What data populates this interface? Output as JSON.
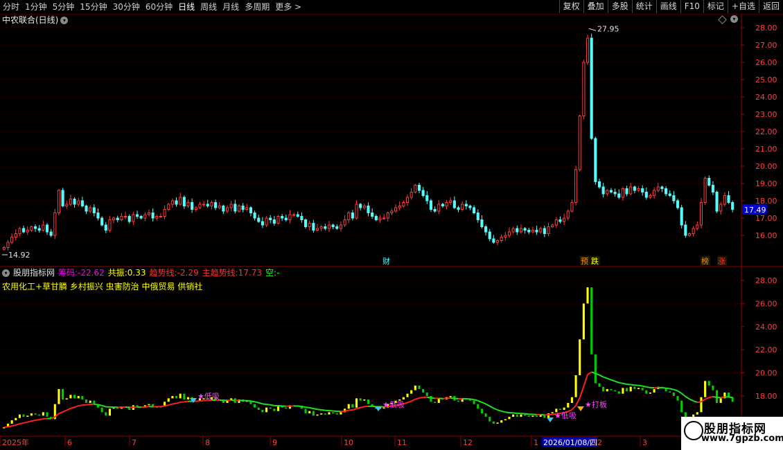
{
  "toolbar": {
    "periods": [
      "分时",
      "1分钟",
      "5分钟",
      "15分钟",
      "30分钟",
      "60分钟",
      "日线",
      "周线",
      "月线",
      "多周期",
      "更多 >"
    ],
    "active_period": "日线",
    "buttons": [
      "复权",
      "叠加",
      "多股",
      "统计",
      "画线",
      "F10",
      "标记",
      "+自选",
      "返回"
    ]
  },
  "main_panel": {
    "title": "中农联合(日线)"
  },
  "indicator": {
    "name": "股朋指标网",
    "chouma_label": "筹码:",
    "chouma_value": "-22.62",
    "gongzhen_label": "共振:",
    "gongzhen_value": "0.33",
    "qushi_label": "趋势线:",
    "qushi_value": "-2.29",
    "zhu_label": "主趋势线:",
    "zhu_value": "17.73",
    "kong_label": "空:",
    "kong_value": "-",
    "concepts": "农用化工+草甘膦 乡村振兴 虫害防治 中俄贸易 供销社"
  },
  "watermark": {
    "line1": "股朋指标网",
    "line2": "www.7gpzb.com"
  },
  "colors": {
    "up": "#ff3c3c",
    "down": "#54fcfc",
    "grid": "#5a0000",
    "trend_up": "#ff2020",
    "trend_down": "#20e020",
    "vol_up": "#ffff00",
    "vol_down": "#00cc00"
  },
  "chart_data": {
    "type": "candlestick",
    "y_ticks_main": [
      "28.00",
      "27.00",
      "26.00",
      "25.00",
      "24.00",
      "23.00",
      "22.00",
      "21.00",
      "20.00",
      "19.00",
      "18.00",
      "17.00",
      "16.00"
    ],
    "y_ticks_ind": [
      "28.00",
      "26.00",
      "24.00",
      "22.00",
      "20.00",
      "18.00"
    ],
    "ylim_main": [
      15.3,
      28.4
    ],
    "ylim_ind": [
      16.2,
      28.8
    ],
    "x_labels": [
      "2025年",
      "6",
      "7",
      "8",
      "9",
      "10",
      "11",
      "12",
      "1",
      "2026/01/08/四",
      "2",
      "3"
    ],
    "max_label": "27.95",
    "min_label": "14.92",
    "last_price": "17.49",
    "event_markers": [
      "财",
      "预",
      "跌",
      "榜",
      "涨"
    ],
    "signal_labels": [
      "低吸",
      "低吸",
      "低吸",
      "打板"
    ],
    "closes": [
      15.3,
      15.6,
      15.9,
      16.1,
      16.4,
      16.2,
      16.3,
      16.5,
      16.4,
      16.3,
      16.6,
      16.2,
      16.0,
      17.3,
      18.6,
      17.7,
      17.8,
      18.1,
      17.8,
      18.0,
      17.7,
      17.4,
      17.6,
      17.3,
      17.0,
      16.6,
      16.3,
      16.9,
      17.0,
      16.9,
      17.1,
      17.1,
      16.8,
      17.2,
      17.1,
      17.0,
      17.2,
      17.3,
      17.0,
      17.1,
      17.1,
      17.5,
      17.8,
      18.0,
      17.8,
      18.2,
      17.7,
      17.9,
      17.5,
      17.6,
      17.8,
      17.8,
      17.7,
      17.9,
      17.6,
      17.7,
      17.4,
      17.6,
      17.8,
      17.4,
      17.7,
      17.5,
      17.6,
      17.3,
      17.0,
      16.8,
      16.6,
      17.0,
      16.9,
      16.7,
      17.1,
      17.0,
      16.9,
      17.2,
      17.2,
      17.1,
      16.9,
      16.5,
      16.7,
      16.3,
      16.4,
      16.5,
      16.4,
      16.6,
      16.5,
      16.4,
      16.6,
      16.9,
      17.3,
      17.0,
      17.8,
      17.6,
      17.7,
      17.3,
      17.1,
      16.9,
      17.0,
      17.0,
      17.3,
      17.4,
      17.6,
      17.7,
      17.9,
      18.2,
      18.5,
      18.9,
      18.6,
      18.3,
      18.0,
      17.5,
      17.4,
      17.8,
      17.7,
      17.9,
      18.0,
      17.6,
      17.5,
      17.8,
      17.7,
      17.6,
      17.3,
      16.9,
      16.5,
      16.2,
      15.8,
      15.6,
      15.7,
      15.9,
      16.0,
      16.2,
      16.4,
      16.2,
      16.4,
      16.3,
      16.2,
      16.3,
      16.2,
      16.4,
      16.1,
      16.5,
      16.6,
      16.9,
      16.8,
      17.0,
      17.4,
      17.9,
      19.8,
      22.9,
      26.0,
      27.4,
      21.6,
      19.1,
      18.8,
      18.4,
      18.6,
      18.5,
      18.4,
      18.2,
      18.7,
      18.4,
      18.8,
      18.6,
      18.7,
      18.5,
      18.2,
      18.3,
      18.6,
      18.8,
      18.7,
      18.4,
      18.3,
      18.0,
      17.6,
      16.6,
      16.0,
      16.1,
      16.4,
      16.6,
      17.9,
      19.3,
      18.9,
      18.5,
      17.4,
      17.8,
      18.3,
      17.9,
      17.5
    ]
  }
}
